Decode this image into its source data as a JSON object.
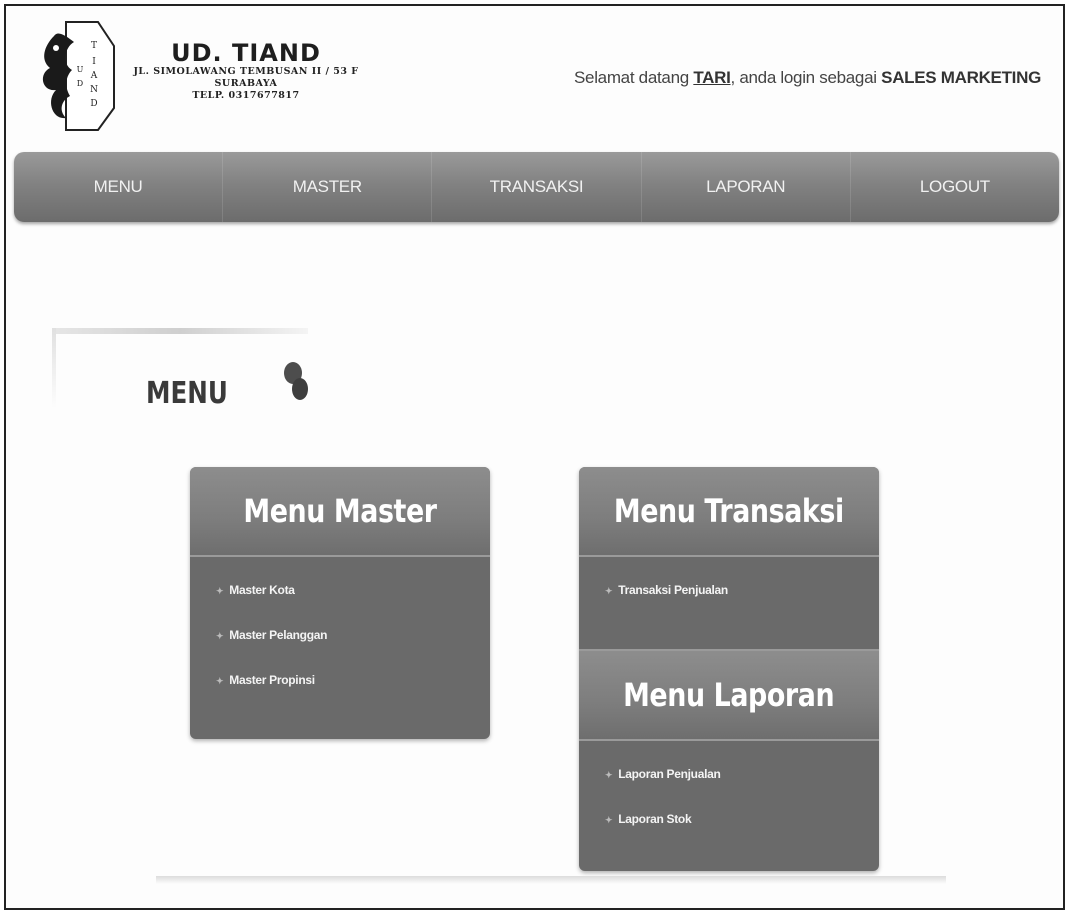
{
  "header": {
    "brand_name": "UD. TIAND",
    "address_line": "JL. SIMOLAWANG TEMBUSAN II / 53 F",
    "city_line": "SURABAYA",
    "phone_line": "TELP. 0317677817",
    "welcome_prefix": "Selamat datang",
    "user_name": "TARI",
    "welcome_middle": ", anda login sebagai",
    "role": "SALES MARKETING"
  },
  "nav": {
    "items": [
      "MENU",
      "MASTER",
      "TRANSAKSI",
      "LAPORAN",
      "LOGOUT"
    ]
  },
  "page": {
    "title": "MENU"
  },
  "panels": {
    "master": {
      "title": "Menu Master",
      "items": [
        "Master Kota",
        "Master Pelanggan",
        "Master Propinsi"
      ]
    },
    "transaksi": {
      "title": "Menu Transaksi",
      "items": [
        "Transaksi Penjualan"
      ]
    },
    "laporan": {
      "title": "Menu Laporan",
      "items": [
        "Laporan Penjualan",
        "Laporan Stok"
      ]
    }
  },
  "icons": {
    "logo": "company-logo-icon",
    "bullet": "bullet-icon",
    "decoration": "blob-decoration-icon"
  },
  "colors": {
    "nav_bg": "#828282",
    "panel_bg": "#6a6a6a",
    "panel_head_bg": "#7d7d7d",
    "text_light": "#ffffff"
  }
}
